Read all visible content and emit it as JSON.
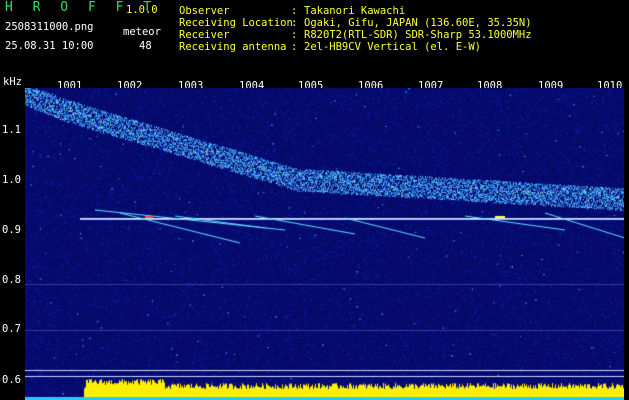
{
  "app": {
    "title": "H R O F F T",
    "version": "1.0.0",
    "file_name": "2508311000.png",
    "datetime": "25.08.31 10:00",
    "meteor_label": "meteor",
    "meteor_count": "48"
  },
  "info": [
    {
      "label": "Observer",
      "value": "Takanori Kawachi"
    },
    {
      "label": "Receiving Location",
      "value": "Ogaki, Gifu, JAPAN (136.60E, 35.35N)"
    },
    {
      "label": "Receiver",
      "value": "R820T2(RTL-SDR) SDR-Sharp 53.1000MHz"
    },
    {
      "label": "Receiving antenna",
      "value": "2el-HB9CV Vertical (el. E-W)"
    }
  ],
  "separator": ":",
  "axis": {
    "unit": "kHz",
    "y_ticks": [
      "1.1",
      "1.0",
      "0.9",
      "0.8",
      "0.7",
      "0.6"
    ],
    "x_ticks": [
      "1001",
      "1002",
      "1003",
      "1004",
      "1005",
      "1006",
      "1007",
      "1008",
      "1009",
      "1010"
    ]
  },
  "colors": {
    "background": "#050a6a",
    "noise": "#1428c8",
    "echo": "#40d0ff",
    "carrier": "#9ab8ff",
    "level_yellow": "#ffee00",
    "level_cyan": "#22ccff"
  }
}
